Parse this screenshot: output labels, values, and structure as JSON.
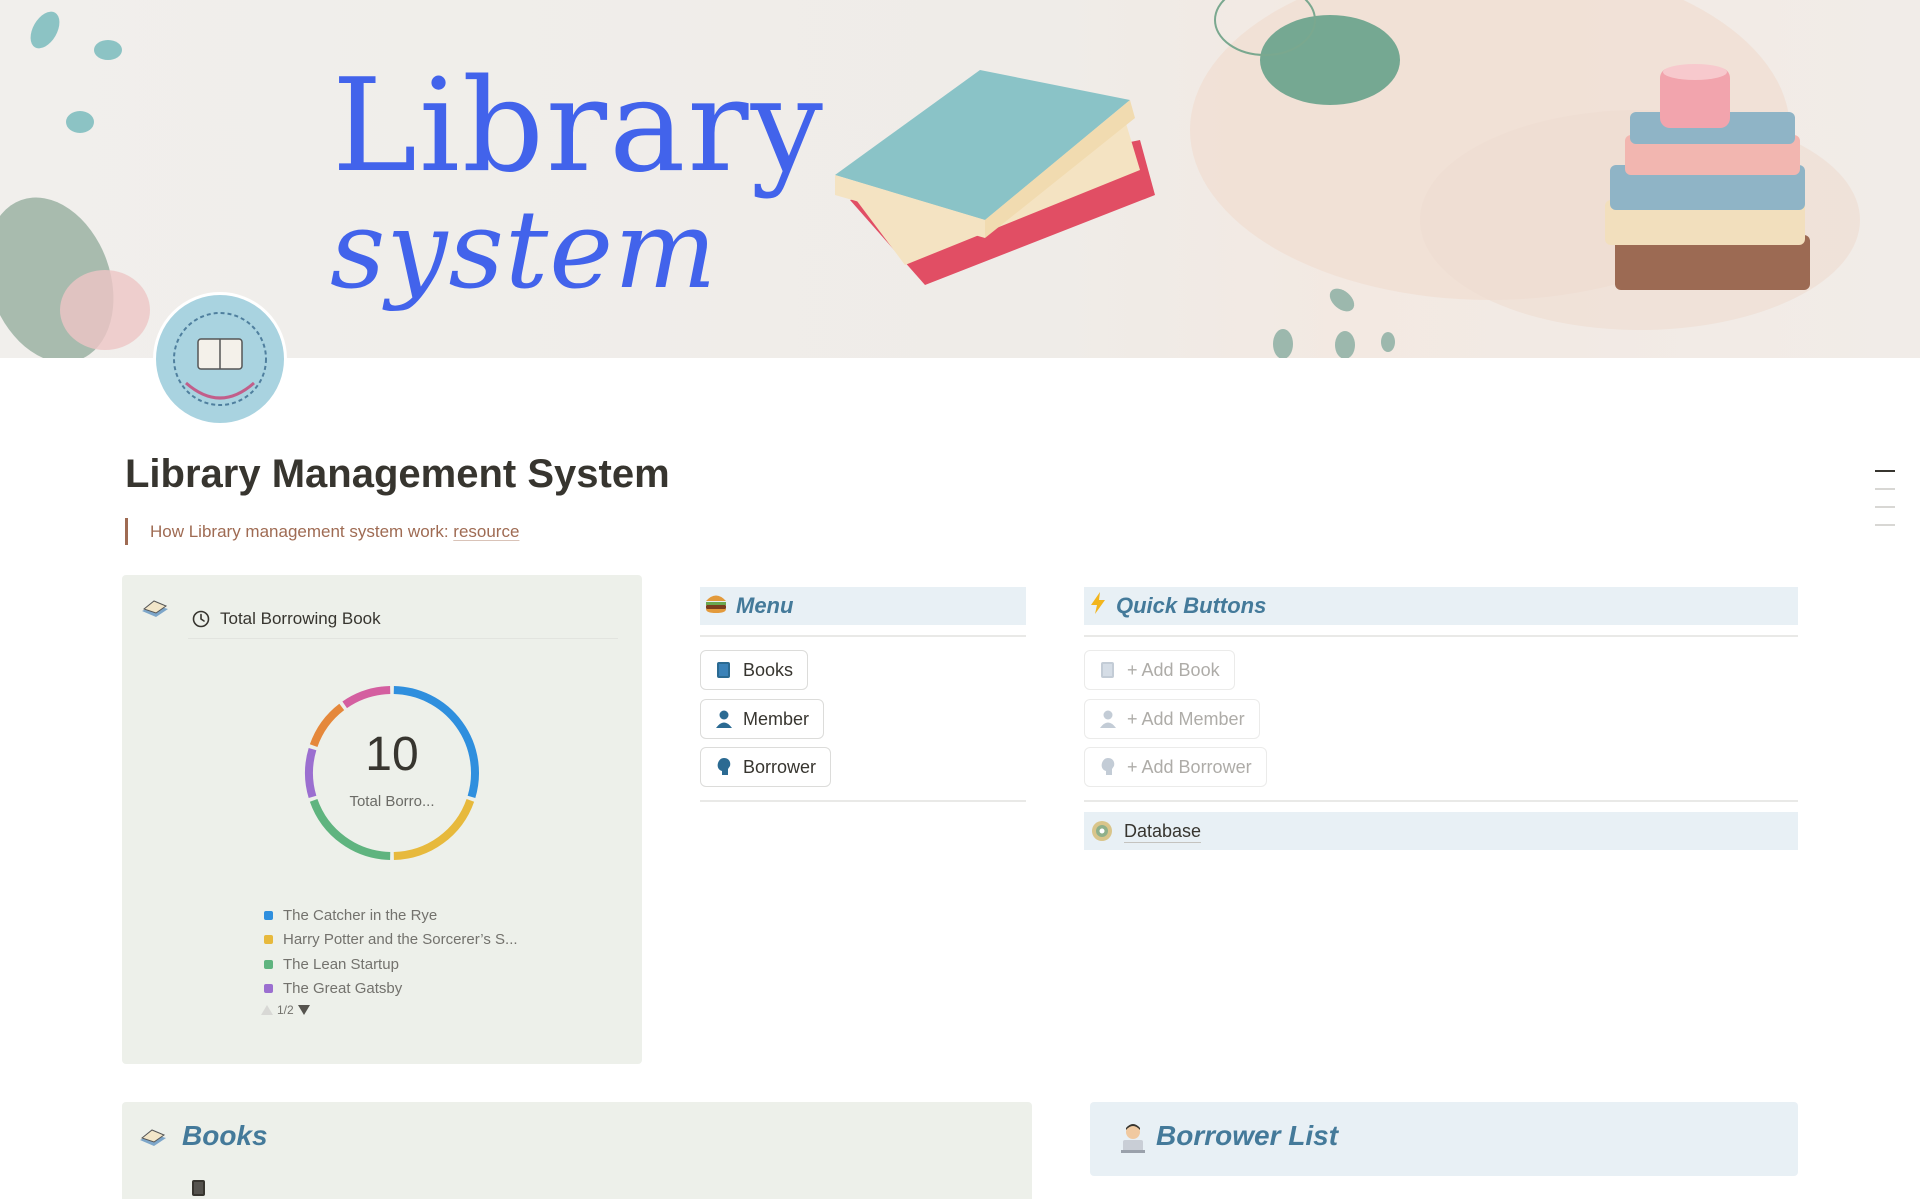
{
  "cover": {
    "title_line1": "Library",
    "title_line2": "system",
    "title_color": "#4263eb"
  },
  "page": {
    "title": "Library Management System",
    "quote_text": "How Library management system work: ",
    "quote_link": "resource"
  },
  "chart_card": {
    "header_label": "Total Borrowing Book",
    "header_icon": "clock-icon"
  },
  "chart_data": {
    "type": "pie",
    "center_value": "10",
    "center_label": "Total Borro...",
    "series": [
      {
        "name": "The Catcher in the Rye",
        "value": 3,
        "color": "#2f8fde"
      },
      {
        "name": "Harry Potter and the Sorcerer’s S...",
        "value": 2,
        "color": "#e7b93c"
      },
      {
        "name": "The Lean Startup",
        "value": 2,
        "color": "#5fb47f"
      },
      {
        "name": "The Great Gatsby",
        "value": 1,
        "color": "#9b6fd0"
      },
      {
        "name": "",
        "value": 1,
        "color": "#e5883b"
      },
      {
        "name": "",
        "value": 1,
        "color": "#d45fa0"
      }
    ],
    "legend_visible_count": 4,
    "legend_page": "1/2"
  },
  "menu": {
    "title": "Menu",
    "icon": "burger-emoji-icon",
    "items": [
      {
        "label": "Books",
        "icon": "book-icon"
      },
      {
        "label": "Member",
        "icon": "person-icon"
      },
      {
        "label": "Borrower",
        "icon": "person-head-icon"
      }
    ]
  },
  "quick": {
    "title": "Quick Buttons",
    "icon": "lightning-icon",
    "items": [
      {
        "label": "+ Add Book",
        "icon": "book-icon"
      },
      {
        "label": "+ Add Member",
        "icon": "person-icon"
      },
      {
        "label": "+ Add Borrower",
        "icon": "person-head-icon"
      }
    ],
    "database_label": "Database"
  },
  "books_section": {
    "title": "Books"
  },
  "borrower_section": {
    "title": "Borrower List"
  },
  "colors": {
    "accent_heading": "#447a9a",
    "card_green": "#edf0ea",
    "card_blue": "#e8f0f5",
    "quote_brown": "#9f6b53"
  }
}
